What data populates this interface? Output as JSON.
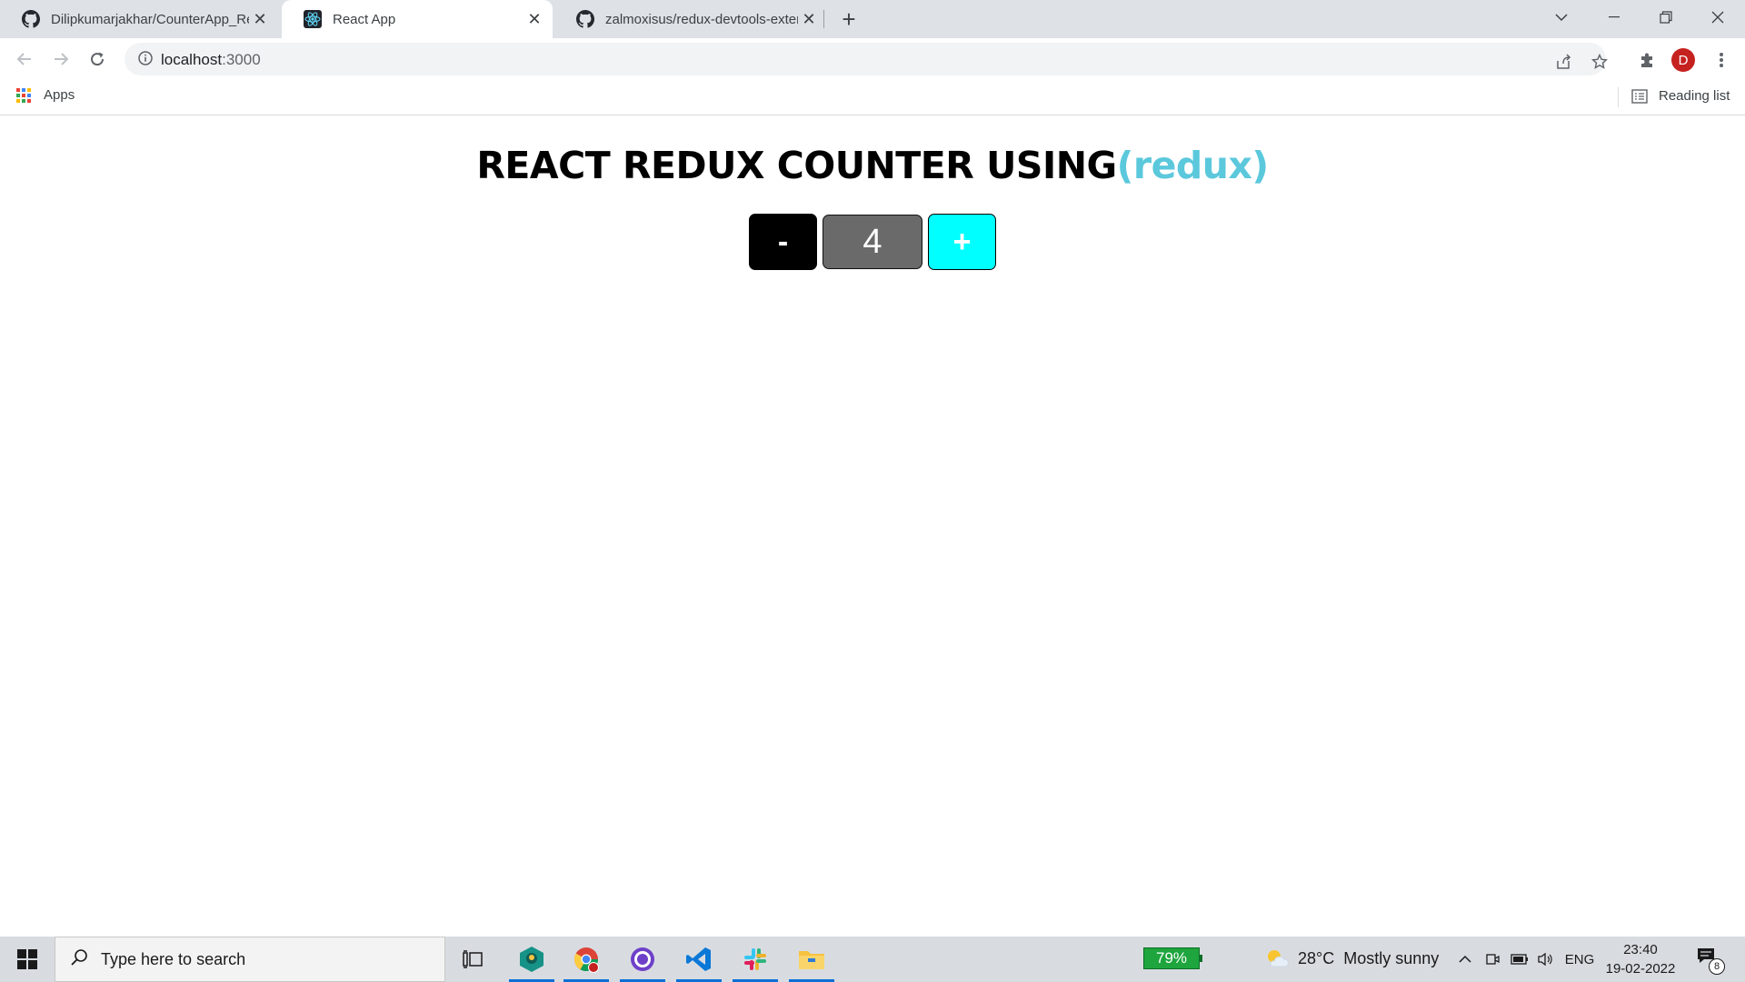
{
  "browser": {
    "tabs": [
      {
        "title": "Dilipkumarjakhar/CounterApp_Re",
        "icon": "github-icon",
        "active": false
      },
      {
        "title": "React App",
        "icon": "react-icon",
        "active": true
      },
      {
        "title": "zalmoxisus/redux-devtools-exten",
        "icon": "github-icon",
        "active": false
      }
    ],
    "address": {
      "host": "localhost",
      "port": ":3000"
    },
    "profile_initial": "D",
    "bookmarks": {
      "apps_label": "Apps",
      "reading_list_label": "Reading list"
    }
  },
  "page": {
    "title_main": "REACT REDUX COUNTER USING",
    "title_accent": "(redux)",
    "accent_color": "#5bc8dc",
    "counter": {
      "decrement_label": "-",
      "value": "4",
      "increment_label": "+"
    }
  },
  "taskbar": {
    "search_placeholder": "Type here to search",
    "apps": [
      "task-view-icon",
      "gitkraken-icon",
      "chrome-icon",
      "github-desktop-icon",
      "vscode-icon",
      "slack-icon",
      "file-explorer-icon"
    ],
    "battery_percent": "79%",
    "weather": {
      "temp": "28°C",
      "condition": "Mostly sunny"
    },
    "language": "ENG",
    "time": "23:40",
    "date": "19-02-2022",
    "notification_count": "8"
  }
}
